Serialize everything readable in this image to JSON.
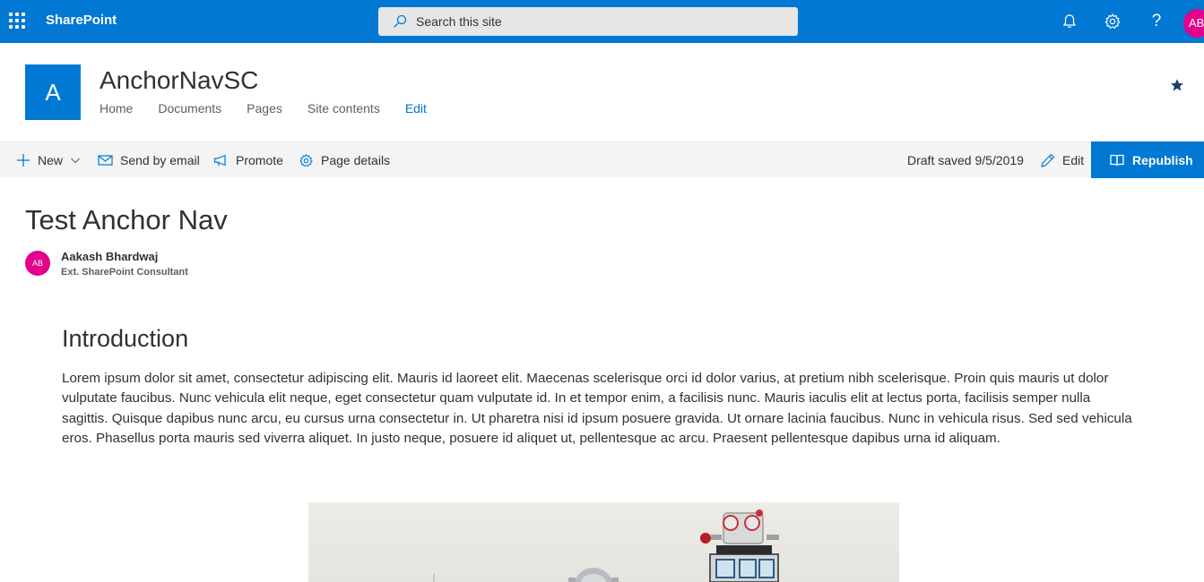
{
  "suite_bar": {
    "app_name": "SharePoint",
    "search_placeholder": "Search this site",
    "user_initials": "AB"
  },
  "site": {
    "logo_letter": "A",
    "title": "AnchorNavSC",
    "nav": [
      "Home",
      "Documents",
      "Pages",
      "Site contents"
    ],
    "nav_edit": "Edit"
  },
  "command_bar": {
    "new_label": "New",
    "send_email_label": "Send by email",
    "promote_label": "Promote",
    "page_details_label": "Page details",
    "draft_status": "Draft saved 9/5/2019",
    "edit_label": "Edit",
    "republish_label": "Republish"
  },
  "page": {
    "title": "Test Anchor Nav",
    "author": {
      "initials": "AB",
      "name": "Aakash Bhardwaj",
      "role": "Ext. SharePoint Consultant"
    },
    "section": {
      "heading": "Introduction",
      "body": "Lorem ipsum dolor sit amet, consectetur adipiscing elit. Mauris id laoreet elit. Maecenas scelerisque orci id dolor varius, at pretium nibh scelerisque. Proin quis mauris ut dolor vulputate faucibus. Nunc vehicula elit neque, eget consectetur quam vulputate id. In et tempor enim, a facilisis nunc. Mauris iaculis elit at lectus porta, facilisis semper nulla sagittis. Quisque dapibus nunc arcu, eu cursus urna consectetur in. Ut pharetra nisi id ipsum posuere gravida. Ut ornare lacinia faucibus. Nunc in vehicula risus. Sed sed vehicula eros. Phasellus porta mauris sed viverra aliquet. In justo neque, posuere id aliquet ut, pellentesque ac arcu. Praesent pellentesque dapibus urna id aliquam."
    }
  },
  "colors": {
    "brand_blue": "#0078d4",
    "avatar_pink": "#e3008c",
    "command_bar_bg": "#f4f4f4"
  },
  "icons": [
    "waffle-icon",
    "search-icon",
    "bell-icon",
    "gear-icon",
    "help-icon",
    "star-icon",
    "plus-icon",
    "chevron-down-icon",
    "mail-icon",
    "megaphone-icon",
    "settings-icon",
    "pencil-icon",
    "book-icon"
  ]
}
